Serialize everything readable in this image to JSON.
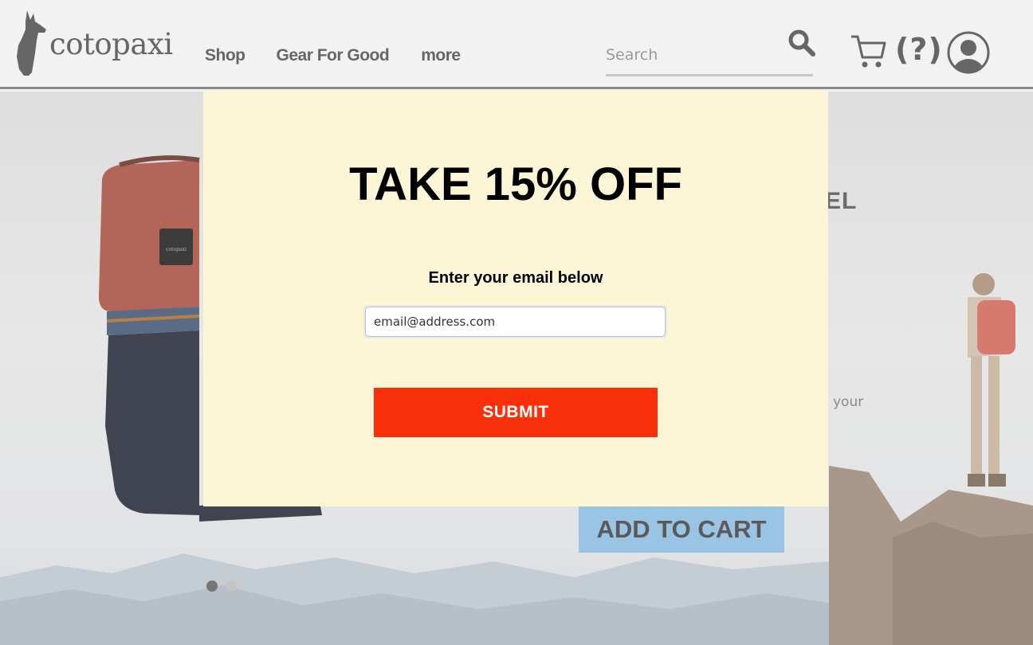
{
  "header": {
    "logo_text": "cotopaxi",
    "nav": [
      {
        "label": "Shop"
      },
      {
        "label": "Gear For Good"
      },
      {
        "label": "more"
      }
    ],
    "search": {
      "placeholder": "Search",
      "value": ""
    },
    "help_label": "(?)"
  },
  "hero": {
    "heading_partial": "EL",
    "desc_partial": "your",
    "add_to_cart_label": "ADD TO CART",
    "carousel": {
      "count": 2,
      "active_index": 0
    }
  },
  "modal": {
    "title": "TAKE 15% OFF",
    "subtitle": "Enter your email below",
    "email_placeholder": "email@address.com",
    "email_value": "",
    "submit_label": "SUBMIT"
  },
  "colors": {
    "modal_bg": "#fcf6d6",
    "submit_bg": "#f9300a",
    "add_to_cart_bg": "#9ac4e3",
    "header_bg": "#f2f2f2"
  }
}
